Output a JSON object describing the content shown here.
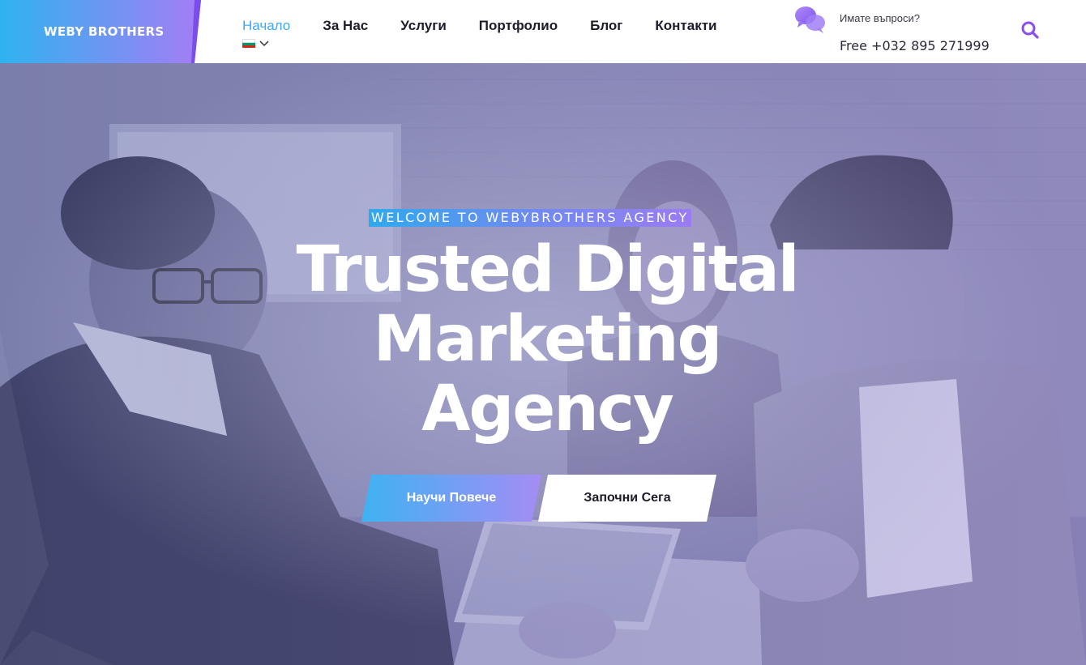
{
  "brand": {
    "name": "WEBY BROTHERS"
  },
  "nav": {
    "items": [
      {
        "label": "Начало",
        "active": true
      },
      {
        "label": "За Нас"
      },
      {
        "label": "Услуги"
      },
      {
        "label": "Портфолио"
      },
      {
        "label": "Блог"
      },
      {
        "label": "Контакти"
      }
    ],
    "language": {
      "flag_icon": "bulgaria-flag-icon",
      "chevron_icon": "chevron-down-icon"
    }
  },
  "contact": {
    "icon": "chat-bubbles-icon",
    "question": "Имате въпроси?",
    "phone": "Free +032 895 271999"
  },
  "search": {
    "icon": "search-icon"
  },
  "hero": {
    "eyebrow": "WELCOME TO WEBYBROTHERS AGENCY",
    "headline": [
      "Trusted Digital",
      "Marketing",
      "Agency"
    ],
    "primary_button": "Научи Повече",
    "secondary_button": "Започни Сега",
    "background_image": "team-meeting-photo"
  },
  "colors": {
    "accent_blue": "#3fa9f5",
    "accent_purple": "#9b7cf2",
    "brand_gradient_start": "#2fb3f0",
    "brand_gradient_end": "#a57cf5",
    "nav_text": "#1c1c2b",
    "search_icon": "#8a4df0"
  }
}
